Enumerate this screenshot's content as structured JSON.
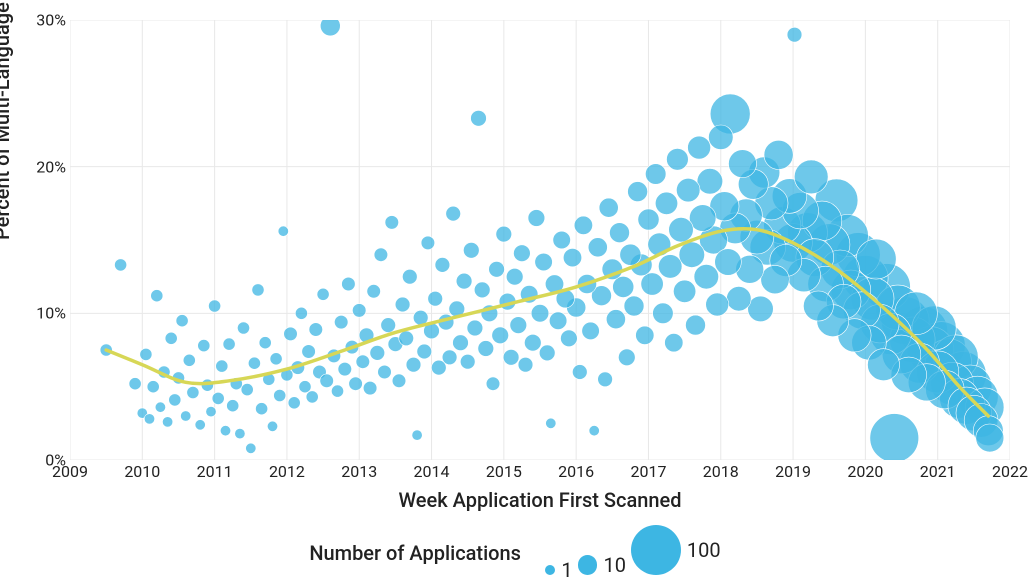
{
  "chart_data": {
    "type": "scatter",
    "title": "",
    "xlabel": "Week Application First Scanned",
    "ylabel": "Percent of Multi-Language Applications",
    "xlim": [
      2009,
      2022
    ],
    "ylim": [
      0,
      30
    ],
    "x_ticks": [
      2009,
      2010,
      2011,
      2012,
      2013,
      2014,
      2015,
      2016,
      2017,
      2018,
      2019,
      2020,
      2021,
      2022
    ],
    "y_ticks": [
      0,
      10,
      20,
      30
    ],
    "y_tick_suffix": "%",
    "legend_title": "Number of Applications",
    "legend_sizes": [
      {
        "label": "1",
        "value": 1
      },
      {
        "label": "10",
        "value": 10
      },
      {
        "label": "100",
        "value": 100
      }
    ],
    "colors": {
      "point_fill": "#3db6e3",
      "trend_line": "#d7d756",
      "grid": "#e8e8e8"
    },
    "trend": [
      {
        "x": 2009.5,
        "y": 7.5
      },
      {
        "x": 2010.0,
        "y": 6.5
      },
      {
        "x": 2010.6,
        "y": 5.3
      },
      {
        "x": 2011.2,
        "y": 5.4
      },
      {
        "x": 2012.0,
        "y": 6.2
      },
      {
        "x": 2012.8,
        "y": 7.5
      },
      {
        "x": 2013.5,
        "y": 8.7
      },
      {
        "x": 2014.3,
        "y": 9.7
      },
      {
        "x": 2015.2,
        "y": 10.8
      },
      {
        "x": 2016.0,
        "y": 11.8
      },
      {
        "x": 2016.8,
        "y": 13.2
      },
      {
        "x": 2017.4,
        "y": 14.6
      },
      {
        "x": 2018.0,
        "y": 15.6
      },
      {
        "x": 2018.5,
        "y": 15.7
      },
      {
        "x": 2019.0,
        "y": 14.8
      },
      {
        "x": 2019.6,
        "y": 13.0
      },
      {
        "x": 2020.2,
        "y": 10.6
      },
      {
        "x": 2020.8,
        "y": 7.8
      },
      {
        "x": 2021.3,
        "y": 5.0
      },
      {
        "x": 2021.7,
        "y": 3.0
      }
    ],
    "points": [
      {
        "x": 2009.5,
        "y": 7.5,
        "n": 2
      },
      {
        "x": 2009.7,
        "y": 13.3,
        "n": 2
      },
      {
        "x": 2009.9,
        "y": 5.2,
        "n": 2
      },
      {
        "x": 2010.0,
        "y": 3.2,
        "n": 1
      },
      {
        "x": 2010.05,
        "y": 7.2,
        "n": 2
      },
      {
        "x": 2010.1,
        "y": 2.8,
        "n": 1
      },
      {
        "x": 2010.15,
        "y": 5.0,
        "n": 2
      },
      {
        "x": 2010.2,
        "y": 11.2,
        "n": 2
      },
      {
        "x": 2010.25,
        "y": 3.6,
        "n": 1
      },
      {
        "x": 2010.3,
        "y": 6.0,
        "n": 2
      },
      {
        "x": 2010.35,
        "y": 2.6,
        "n": 1
      },
      {
        "x": 2010.4,
        "y": 8.3,
        "n": 2
      },
      {
        "x": 2010.45,
        "y": 4.1,
        "n": 2
      },
      {
        "x": 2010.5,
        "y": 5.6,
        "n": 2
      },
      {
        "x": 2010.55,
        "y": 9.5,
        "n": 2
      },
      {
        "x": 2010.6,
        "y": 3.0,
        "n": 1
      },
      {
        "x": 2010.65,
        "y": 6.8,
        "n": 2
      },
      {
        "x": 2010.7,
        "y": 4.6,
        "n": 2
      },
      {
        "x": 2010.8,
        "y": 2.4,
        "n": 1
      },
      {
        "x": 2010.85,
        "y": 7.8,
        "n": 2
      },
      {
        "x": 2010.9,
        "y": 5.1,
        "n": 2
      },
      {
        "x": 2010.95,
        "y": 3.3,
        "n": 1
      },
      {
        "x": 2011.0,
        "y": 10.5,
        "n": 2
      },
      {
        "x": 2011.05,
        "y": 4.2,
        "n": 2
      },
      {
        "x": 2011.1,
        "y": 6.4,
        "n": 2
      },
      {
        "x": 2011.15,
        "y": 2.0,
        "n": 1
      },
      {
        "x": 2011.2,
        "y": 7.9,
        "n": 2
      },
      {
        "x": 2011.25,
        "y": 3.7,
        "n": 2
      },
      {
        "x": 2011.3,
        "y": 5.2,
        "n": 2
      },
      {
        "x": 2011.35,
        "y": 1.8,
        "n": 1
      },
      {
        "x": 2011.4,
        "y": 9.0,
        "n": 2
      },
      {
        "x": 2011.45,
        "y": 4.8,
        "n": 2
      },
      {
        "x": 2011.5,
        "y": 0.8,
        "n": 1
      },
      {
        "x": 2011.55,
        "y": 6.6,
        "n": 2
      },
      {
        "x": 2011.6,
        "y": 11.6,
        "n": 2
      },
      {
        "x": 2011.65,
        "y": 3.5,
        "n": 2
      },
      {
        "x": 2011.7,
        "y": 8.0,
        "n": 2
      },
      {
        "x": 2011.75,
        "y": 5.5,
        "n": 2
      },
      {
        "x": 2011.8,
        "y": 2.3,
        "n": 1
      },
      {
        "x": 2011.85,
        "y": 6.9,
        "n": 2
      },
      {
        "x": 2011.9,
        "y": 4.4,
        "n": 2
      },
      {
        "x": 2011.95,
        "y": 15.6,
        "n": 1
      },
      {
        "x": 2012.0,
        "y": 5.8,
        "n": 2
      },
      {
        "x": 2012.05,
        "y": 8.6,
        "n": 3
      },
      {
        "x": 2012.1,
        "y": 3.9,
        "n": 2
      },
      {
        "x": 2012.15,
        "y": 6.3,
        "n": 3
      },
      {
        "x": 2012.2,
        "y": 10.0,
        "n": 2
      },
      {
        "x": 2012.25,
        "y": 5.0,
        "n": 2
      },
      {
        "x": 2012.3,
        "y": 7.4,
        "n": 3
      },
      {
        "x": 2012.35,
        "y": 4.3,
        "n": 2
      },
      {
        "x": 2012.4,
        "y": 8.9,
        "n": 3
      },
      {
        "x": 2012.45,
        "y": 6.0,
        "n": 3
      },
      {
        "x": 2012.5,
        "y": 11.3,
        "n": 2
      },
      {
        "x": 2012.55,
        "y": 5.4,
        "n": 3
      },
      {
        "x": 2012.6,
        "y": 29.6,
        "n": 10
      },
      {
        "x": 2012.65,
        "y": 7.1,
        "n": 3
      },
      {
        "x": 2012.7,
        "y": 4.7,
        "n": 2
      },
      {
        "x": 2012.75,
        "y": 9.4,
        "n": 3
      },
      {
        "x": 2012.8,
        "y": 6.2,
        "n": 3
      },
      {
        "x": 2012.85,
        "y": 12.0,
        "n": 3
      },
      {
        "x": 2012.9,
        "y": 7.7,
        "n": 3
      },
      {
        "x": 2012.95,
        "y": 5.2,
        "n": 3
      },
      {
        "x": 2013.0,
        "y": 10.2,
        "n": 3
      },
      {
        "x": 2013.05,
        "y": 6.7,
        "n": 3
      },
      {
        "x": 2013.1,
        "y": 8.5,
        "n": 4
      },
      {
        "x": 2013.15,
        "y": 4.9,
        "n": 3
      },
      {
        "x": 2013.2,
        "y": 11.5,
        "n": 3
      },
      {
        "x": 2013.25,
        "y": 7.3,
        "n": 4
      },
      {
        "x": 2013.3,
        "y": 14.0,
        "n": 3
      },
      {
        "x": 2013.35,
        "y": 6.0,
        "n": 3
      },
      {
        "x": 2013.4,
        "y": 9.2,
        "n": 4
      },
      {
        "x": 2013.45,
        "y": 16.2,
        "n": 3
      },
      {
        "x": 2013.5,
        "y": 7.9,
        "n": 4
      },
      {
        "x": 2013.55,
        "y": 5.4,
        "n": 3
      },
      {
        "x": 2013.6,
        "y": 10.6,
        "n": 4
      },
      {
        "x": 2013.65,
        "y": 8.3,
        "n": 4
      },
      {
        "x": 2013.7,
        "y": 12.5,
        "n": 4
      },
      {
        "x": 2013.75,
        "y": 6.5,
        "n": 4
      },
      {
        "x": 2013.8,
        "y": 1.7,
        "n": 1
      },
      {
        "x": 2013.85,
        "y": 9.7,
        "n": 4
      },
      {
        "x": 2013.9,
        "y": 7.4,
        "n": 4
      },
      {
        "x": 2013.95,
        "y": 14.8,
        "n": 3
      },
      {
        "x": 2014.0,
        "y": 8.8,
        "n": 5
      },
      {
        "x": 2014.05,
        "y": 11.0,
        "n": 4
      },
      {
        "x": 2014.1,
        "y": 6.3,
        "n": 4
      },
      {
        "x": 2014.15,
        "y": 13.3,
        "n": 4
      },
      {
        "x": 2014.2,
        "y": 9.4,
        "n": 5
      },
      {
        "x": 2014.25,
        "y": 7.0,
        "n": 4
      },
      {
        "x": 2014.3,
        "y": 16.8,
        "n": 4
      },
      {
        "x": 2014.35,
        "y": 10.3,
        "n": 5
      },
      {
        "x": 2014.4,
        "y": 8.0,
        "n": 5
      },
      {
        "x": 2014.45,
        "y": 12.2,
        "n": 5
      },
      {
        "x": 2014.5,
        "y": 6.7,
        "n": 4
      },
      {
        "x": 2014.55,
        "y": 14.3,
        "n": 5
      },
      {
        "x": 2014.6,
        "y": 9.0,
        "n": 5
      },
      {
        "x": 2014.65,
        "y": 23.3,
        "n": 5
      },
      {
        "x": 2014.7,
        "y": 11.6,
        "n": 5
      },
      {
        "x": 2014.75,
        "y": 7.6,
        "n": 5
      },
      {
        "x": 2014.8,
        "y": 10.0,
        "n": 6
      },
      {
        "x": 2014.85,
        "y": 5.2,
        "n": 3
      },
      {
        "x": 2014.9,
        "y": 13.0,
        "n": 5
      },
      {
        "x": 2014.95,
        "y": 8.5,
        "n": 6
      },
      {
        "x": 2015.0,
        "y": 15.4,
        "n": 5
      },
      {
        "x": 2015.05,
        "y": 10.8,
        "n": 6
      },
      {
        "x": 2015.1,
        "y": 7.0,
        "n": 5
      },
      {
        "x": 2015.15,
        "y": 12.5,
        "n": 6
      },
      {
        "x": 2015.2,
        "y": 9.2,
        "n": 6
      },
      {
        "x": 2015.25,
        "y": 14.1,
        "n": 6
      },
      {
        "x": 2015.3,
        "y": 6.5,
        "n": 4
      },
      {
        "x": 2015.35,
        "y": 11.3,
        "n": 7
      },
      {
        "x": 2015.4,
        "y": 8.0,
        "n": 6
      },
      {
        "x": 2015.45,
        "y": 16.5,
        "n": 6
      },
      {
        "x": 2015.5,
        "y": 10.0,
        "n": 7
      },
      {
        "x": 2015.55,
        "y": 13.5,
        "n": 7
      },
      {
        "x": 2015.6,
        "y": 7.3,
        "n": 5
      },
      {
        "x": 2015.65,
        "y": 2.5,
        "n": 1
      },
      {
        "x": 2015.7,
        "y": 12.0,
        "n": 8
      },
      {
        "x": 2015.75,
        "y": 9.5,
        "n": 7
      },
      {
        "x": 2015.8,
        "y": 15.0,
        "n": 7
      },
      {
        "x": 2015.85,
        "y": 11.0,
        "n": 8
      },
      {
        "x": 2015.9,
        "y": 8.3,
        "n": 6
      },
      {
        "x": 2015.95,
        "y": 13.8,
        "n": 8
      },
      {
        "x": 2016.0,
        "y": 10.4,
        "n": 9
      },
      {
        "x": 2016.05,
        "y": 6.0,
        "n": 4
      },
      {
        "x": 2016.1,
        "y": 16.0,
        "n": 8
      },
      {
        "x": 2016.15,
        "y": 12.0,
        "n": 9
      },
      {
        "x": 2016.2,
        "y": 8.8,
        "n": 7
      },
      {
        "x": 2016.25,
        "y": 2.0,
        "n": 1
      },
      {
        "x": 2016.3,
        "y": 14.5,
        "n": 9
      },
      {
        "x": 2016.35,
        "y": 11.2,
        "n": 10
      },
      {
        "x": 2016.4,
        "y": 5.5,
        "n": 4
      },
      {
        "x": 2016.45,
        "y": 17.2,
        "n": 9
      },
      {
        "x": 2016.5,
        "y": 13.0,
        "n": 11
      },
      {
        "x": 2016.55,
        "y": 9.6,
        "n": 9
      },
      {
        "x": 2016.6,
        "y": 15.5,
        "n": 10
      },
      {
        "x": 2016.65,
        "y": 11.8,
        "n": 12
      },
      {
        "x": 2016.7,
        "y": 7.0,
        "n": 6
      },
      {
        "x": 2016.75,
        "y": 14.0,
        "n": 12
      },
      {
        "x": 2016.8,
        "y": 10.5,
        "n": 10
      },
      {
        "x": 2016.85,
        "y": 18.3,
        "n": 10
      },
      {
        "x": 2016.9,
        "y": 13.3,
        "n": 13
      },
      {
        "x": 2016.95,
        "y": 8.5,
        "n": 8
      },
      {
        "x": 2017.0,
        "y": 16.4,
        "n": 12
      },
      {
        "x": 2017.05,
        "y": 12.0,
        "n": 14
      },
      {
        "x": 2017.1,
        "y": 19.5,
        "n": 11
      },
      {
        "x": 2017.15,
        "y": 14.7,
        "n": 15
      },
      {
        "x": 2017.2,
        "y": 10.0,
        "n": 11
      },
      {
        "x": 2017.25,
        "y": 17.5,
        "n": 14
      },
      {
        "x": 2017.3,
        "y": 13.2,
        "n": 16
      },
      {
        "x": 2017.35,
        "y": 8.0,
        "n": 8
      },
      {
        "x": 2017.4,
        "y": 20.5,
        "n": 13
      },
      {
        "x": 2017.45,
        "y": 15.7,
        "n": 18
      },
      {
        "x": 2017.5,
        "y": 11.5,
        "n": 14
      },
      {
        "x": 2017.55,
        "y": 18.4,
        "n": 16
      },
      {
        "x": 2017.6,
        "y": 14.0,
        "n": 20
      },
      {
        "x": 2017.65,
        "y": 9.2,
        "n": 10
      },
      {
        "x": 2017.7,
        "y": 21.3,
        "n": 15
      },
      {
        "x": 2017.75,
        "y": 16.5,
        "n": 22
      },
      {
        "x": 2017.8,
        "y": 12.5,
        "n": 18
      },
      {
        "x": 2017.85,
        "y": 19.0,
        "n": 20
      },
      {
        "x": 2017.9,
        "y": 15.0,
        "n": 25
      },
      {
        "x": 2017.95,
        "y": 10.6,
        "n": 15
      },
      {
        "x": 2018.0,
        "y": 22.0,
        "n": 18
      },
      {
        "x": 2018.05,
        "y": 17.3,
        "n": 28
      },
      {
        "x": 2018.1,
        "y": 13.5,
        "n": 22
      },
      {
        "x": 2018.13,
        "y": 23.6,
        "n": 60
      },
      {
        "x": 2018.2,
        "y": 15.8,
        "n": 32
      },
      {
        "x": 2018.25,
        "y": 11.0,
        "n": 18
      },
      {
        "x": 2018.3,
        "y": 20.2,
        "n": 25
      },
      {
        "x": 2018.35,
        "y": 16.7,
        "n": 36
      },
      {
        "x": 2018.4,
        "y": 13.0,
        "n": 25
      },
      {
        "x": 2018.45,
        "y": 18.8,
        "n": 30
      },
      {
        "x": 2018.5,
        "y": 15.2,
        "n": 40
      },
      {
        "x": 2018.55,
        "y": 10.3,
        "n": 20
      },
      {
        "x": 2018.6,
        "y": 19.6,
        "n": 33
      },
      {
        "x": 2018.65,
        "y": 14.5,
        "n": 45
      },
      {
        "x": 2018.7,
        "y": 17.5,
        "n": 38
      },
      {
        "x": 2018.75,
        "y": 12.3,
        "n": 26
      },
      {
        "x": 2018.8,
        "y": 20.8,
        "n": 28
      },
      {
        "x": 2018.85,
        "y": 16.0,
        "n": 50
      },
      {
        "x": 2018.9,
        "y": 13.6,
        "n": 35
      },
      {
        "x": 2018.95,
        "y": 18.0,
        "n": 42
      },
      {
        "x": 2019.0,
        "y": 14.8,
        "n": 55
      },
      {
        "x": 2019.02,
        "y": 29.0,
        "n": 4
      },
      {
        "x": 2019.1,
        "y": 17.0,
        "n": 48
      },
      {
        "x": 2019.15,
        "y": 12.6,
        "n": 38
      },
      {
        "x": 2019.2,
        "y": 15.5,
        "n": 60
      },
      {
        "x": 2019.25,
        "y": 19.3,
        "n": 40
      },
      {
        "x": 2019.3,
        "y": 13.8,
        "n": 52
      },
      {
        "x": 2019.35,
        "y": 10.5,
        "n": 30
      },
      {
        "x": 2019.4,
        "y": 16.3,
        "n": 58
      },
      {
        "x": 2019.45,
        "y": 12.0,
        "n": 45
      },
      {
        "x": 2019.5,
        "y": 14.7,
        "n": 65
      },
      {
        "x": 2019.55,
        "y": 9.5,
        "n": 35
      },
      {
        "x": 2019.6,
        "y": 17.7,
        "n": 70
      },
      {
        "x": 2019.65,
        "y": 13.0,
        "n": 55
      },
      {
        "x": 2019.7,
        "y": 10.8,
        "n": 42
      },
      {
        "x": 2019.75,
        "y": 15.3,
        "n": 68
      },
      {
        "x": 2019.8,
        "y": 11.6,
        "n": 58
      },
      {
        "x": 2019.85,
        "y": 8.5,
        "n": 38
      },
      {
        "x": 2019.9,
        "y": 14.0,
        "n": 75
      },
      {
        "x": 2019.95,
        "y": 10.2,
        "n": 50
      },
      {
        "x": 2020.0,
        "y": 12.4,
        "n": 80
      },
      {
        "x": 2020.05,
        "y": 8.0,
        "n": 42
      },
      {
        "x": 2020.1,
        "y": 11.0,
        "n": 70
      },
      {
        "x": 2020.15,
        "y": 13.7,
        "n": 60
      },
      {
        "x": 2020.2,
        "y": 9.3,
        "n": 55
      },
      {
        "x": 2020.25,
        "y": 6.5,
        "n": 35
      },
      {
        "x": 2020.3,
        "y": 11.8,
        "n": 85
      },
      {
        "x": 2020.35,
        "y": 8.6,
        "n": 65
      },
      {
        "x": 2020.4,
        "y": 1.5,
        "n": 95
      },
      {
        "x": 2020.45,
        "y": 10.4,
        "n": 78
      },
      {
        "x": 2020.5,
        "y": 7.2,
        "n": 55
      },
      {
        "x": 2020.55,
        "y": 9.5,
        "n": 90
      },
      {
        "x": 2020.6,
        "y": 5.8,
        "n": 45
      },
      {
        "x": 2020.65,
        "y": 8.2,
        "n": 80
      },
      {
        "x": 2020.7,
        "y": 10.0,
        "n": 70
      },
      {
        "x": 2020.75,
        "y": 6.6,
        "n": 60
      },
      {
        "x": 2020.8,
        "y": 8.8,
        "n": 95
      },
      {
        "x": 2020.85,
        "y": 5.3,
        "n": 50
      },
      {
        "x": 2020.9,
        "y": 7.5,
        "n": 85
      },
      {
        "x": 2020.95,
        "y": 9.0,
        "n": 75
      },
      {
        "x": 2021.0,
        "y": 6.0,
        "n": 68
      },
      {
        "x": 2021.05,
        "y": 7.8,
        "n": 90
      },
      {
        "x": 2021.1,
        "y": 4.8,
        "n": 55
      },
      {
        "x": 2021.15,
        "y": 6.7,
        "n": 82
      },
      {
        "x": 2021.2,
        "y": 5.2,
        "n": 70
      },
      {
        "x": 2021.25,
        "y": 7.0,
        "n": 78
      },
      {
        "x": 2021.3,
        "y": 4.2,
        "n": 58
      },
      {
        "x": 2021.35,
        "y": 5.8,
        "n": 85
      },
      {
        "x": 2021.4,
        "y": 3.7,
        "n": 50
      },
      {
        "x": 2021.45,
        "y": 5.0,
        "n": 72
      },
      {
        "x": 2021.5,
        "y": 3.2,
        "n": 45
      },
      {
        "x": 2021.55,
        "y": 4.3,
        "n": 65
      },
      {
        "x": 2021.6,
        "y": 2.7,
        "n": 40
      },
      {
        "x": 2021.65,
        "y": 3.6,
        "n": 55
      },
      {
        "x": 2021.7,
        "y": 2.0,
        "n": 30
      },
      {
        "x": 2021.72,
        "y": 1.5,
        "n": 25
      }
    ]
  }
}
